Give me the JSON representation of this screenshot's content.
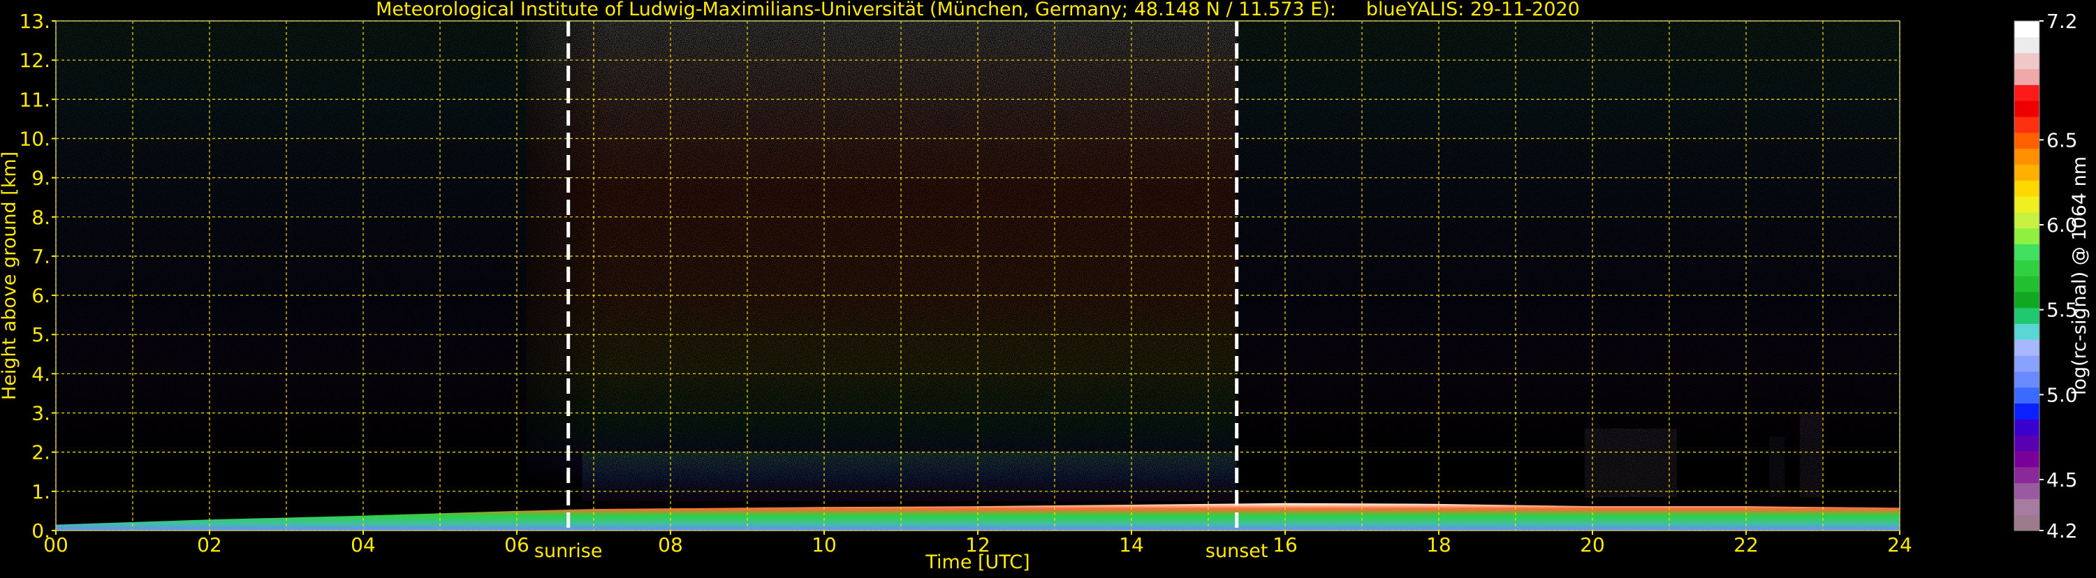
{
  "chart_data": {
    "type": "heatmap",
    "title": "Meteorological Institute of Ludwig-Maximilians-Universität (München, Germany; 48.148 N / 11.573 E):     blueYALIS: 29-11-2020",
    "xlabel": "Time [UTC]",
    "ylabel": "Height above ground [km]",
    "colorbar_label": "log(rc-signal) @ 1064 nm",
    "xlim": [
      0,
      24
    ],
    "ylim": [
      0,
      13
    ],
    "x_ticks": [
      {
        "value": 0,
        "label": "00"
      },
      {
        "value": 2,
        "label": "02"
      },
      {
        "value": 4,
        "label": "04"
      },
      {
        "value": 6,
        "label": "06"
      },
      {
        "value": 8,
        "label": "08"
      },
      {
        "value": 10,
        "label": "10"
      },
      {
        "value": 12,
        "label": "12"
      },
      {
        "value": 14,
        "label": "14"
      },
      {
        "value": 16,
        "label": "16"
      },
      {
        "value": 18,
        "label": "18"
      },
      {
        "value": 20,
        "label": "20"
      },
      {
        "value": 22,
        "label": "22"
      },
      {
        "value": 24,
        "label": "24"
      }
    ],
    "y_ticks": [
      {
        "value": 0,
        "label": "0."
      },
      {
        "value": 1,
        "label": "1."
      },
      {
        "value": 2,
        "label": "2."
      },
      {
        "value": 3,
        "label": "3."
      },
      {
        "value": 4,
        "label": "4."
      },
      {
        "value": 5,
        "label": "5."
      },
      {
        "value": 6,
        "label": "6."
      },
      {
        "value": 7,
        "label": "7."
      },
      {
        "value": 8,
        "label": "8."
      },
      {
        "value": 9,
        "label": "9."
      },
      {
        "value": 10,
        "label": "10."
      },
      {
        "value": 11,
        "label": "11."
      },
      {
        "value": 12,
        "label": "12."
      },
      {
        "value": 13,
        "label": "13."
      }
    ],
    "grid": true,
    "grid_color": "#ffea00",
    "annotations": [
      {
        "label": "sunrise",
        "x": 6.67
      },
      {
        "label": "sunset",
        "x": 15.37
      }
    ],
    "colorbar": {
      "range": [
        4.2,
        7.2
      ],
      "ticks": [
        {
          "value": 4.2,
          "label": "4.2"
        },
        {
          "value": 4.5,
          "label": "4.5"
        },
        {
          "value": 5.0,
          "label": "5.0"
        },
        {
          "value": 5.5,
          "label": "5.5"
        },
        {
          "value": 6.0,
          "label": "6.0"
        },
        {
          "value": 6.5,
          "label": "6.5"
        },
        {
          "value": 7.2,
          "label": "7.2"
        }
      ],
      "colors": [
        "#9c7c8c",
        "#a87ca0",
        "#9a5aa0",
        "#8a2a9a",
        "#7a009a",
        "#5a00b0",
        "#3a00d0",
        "#0a20ff",
        "#3a6aff",
        "#6a8aff",
        "#8aa2ff",
        "#a8b8ff",
        "#5ad6d6",
        "#20c870",
        "#10a820",
        "#20c030",
        "#30d040",
        "#40e060",
        "#90f040",
        "#c8f040",
        "#f0f020",
        "#ffd800",
        "#ffb000",
        "#ff9000",
        "#ff6000",
        "#ff3010",
        "#ee0000",
        "#ff1a1a",
        "#f0a8a8",
        "#f0c8c8",
        "#ececec",
        "#ffffff"
      ]
    }
  }
}
